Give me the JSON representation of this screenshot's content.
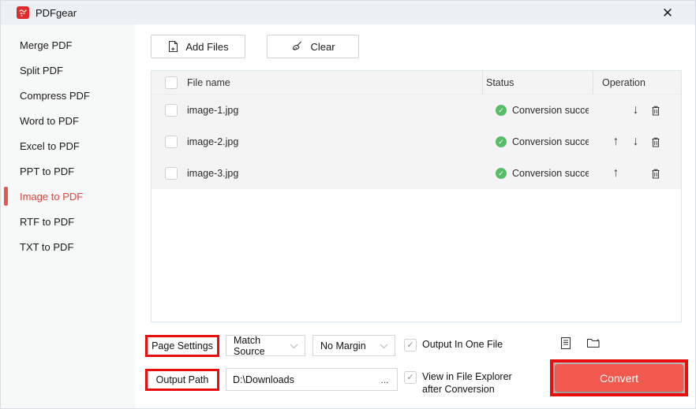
{
  "window": {
    "title": "PDFgear",
    "close_glyph": "✕"
  },
  "sidebar": {
    "items": [
      {
        "label": "Merge PDF",
        "active": false
      },
      {
        "label": "Split PDF",
        "active": false
      },
      {
        "label": "Compress PDF",
        "active": false
      },
      {
        "label": "Word to PDF",
        "active": false
      },
      {
        "label": "Excel to PDF",
        "active": false
      },
      {
        "label": "PPT to PDF",
        "active": false
      },
      {
        "label": "Image to PDF",
        "active": true
      },
      {
        "label": "RTF to PDF",
        "active": false
      },
      {
        "label": "TXT to PDF",
        "active": false
      }
    ]
  },
  "toolbar": {
    "add_files_label": "Add Files",
    "clear_label": "Clear"
  },
  "table": {
    "columns": {
      "name": "File name",
      "status": "Status",
      "operation": "Operation"
    },
    "rows": [
      {
        "name": "image-1.jpg",
        "status": "Conversion succeeded",
        "can_move_up": false,
        "can_move_down": true
      },
      {
        "name": "image-2.jpg",
        "status": "Conversion succeeded",
        "can_move_up": true,
        "can_move_down": true
      },
      {
        "name": "image-3.jpg",
        "status": "Conversion succeeded",
        "can_move_up": true,
        "can_move_down": false
      }
    ]
  },
  "settings": {
    "page_settings_label": "Page Settings",
    "page_size_value": "Match Source",
    "margin_value": "No Margin",
    "output_one_file_label": "Output In One File",
    "output_path_label": "Output Path",
    "output_path_value": "D:\\Downloads",
    "browse_label": "...",
    "view_explorer_label": "View in File Explorer after Conversion",
    "convert_label": "Convert"
  },
  "glyphs": {
    "check": "✓",
    "arrow_up": "↑",
    "arrow_down": "↓"
  },
  "colors": {
    "annotation": "#e90d0d",
    "accent": "#f0594e",
    "active_item": "#d9453f",
    "status_success": "#57bd66"
  }
}
